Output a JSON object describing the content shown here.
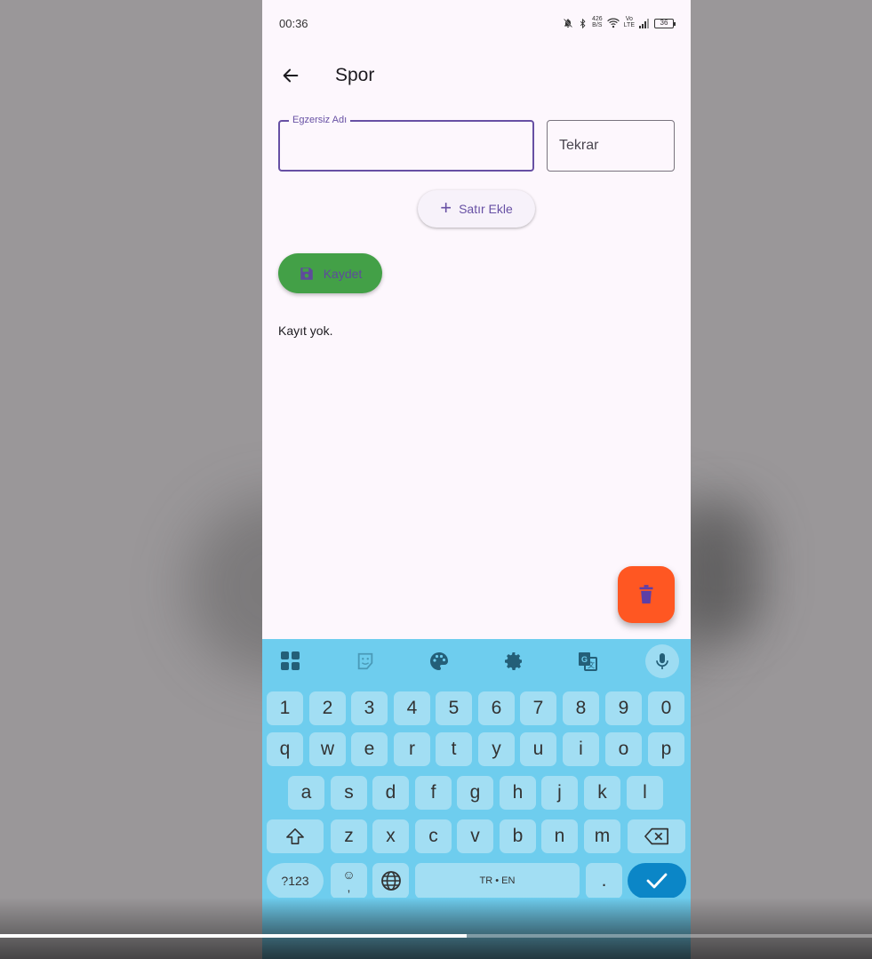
{
  "status_bar": {
    "time": "00:36",
    "speed_value": "426",
    "speed_unit": "B/S",
    "volte_top": "Vo",
    "volte_bottom": "LTE",
    "battery": "36"
  },
  "app_bar": {
    "title": "Spor",
    "back_icon": "arrow-left-icon"
  },
  "form": {
    "exercise_label": "Egzersiz Adı",
    "exercise_value": "",
    "repeat_placeholder": "Tekrar",
    "add_row_label": "Satır Ekle",
    "save_label": "Kaydet"
  },
  "content": {
    "empty_text": "Kayıt yok."
  },
  "fab": {
    "icon": "trash-icon",
    "color": "#ff5722"
  },
  "keyboard": {
    "toolbar_icons": [
      "apps-icon",
      "sticker-icon",
      "palette-icon",
      "gear-icon",
      "translate-icon",
      "mic-icon"
    ],
    "row_numbers": [
      "1",
      "2",
      "3",
      "4",
      "5",
      "6",
      "7",
      "8",
      "9",
      "0"
    ],
    "row_1": [
      "q",
      "w",
      "e",
      "r",
      "t",
      "y",
      "u",
      "i",
      "o",
      "p"
    ],
    "row_2": [
      "a",
      "s",
      "d",
      "f",
      "g",
      "h",
      "j",
      "k",
      "l"
    ],
    "row_3": [
      "z",
      "x",
      "c",
      "v",
      "b",
      "n",
      "m"
    ],
    "symbols_label": "?123",
    "emoji_label": "☺",
    "comma_label": ",",
    "space_label": "TR • EN",
    "period_label": "."
  },
  "video": {
    "progress": 0.535
  },
  "colors": {
    "primary": "#6750a4",
    "save_green": "#43a047",
    "keyboard_bg": "#6ecdee",
    "key_bg": "#a2def3",
    "enter_bg": "#0b86c7"
  }
}
